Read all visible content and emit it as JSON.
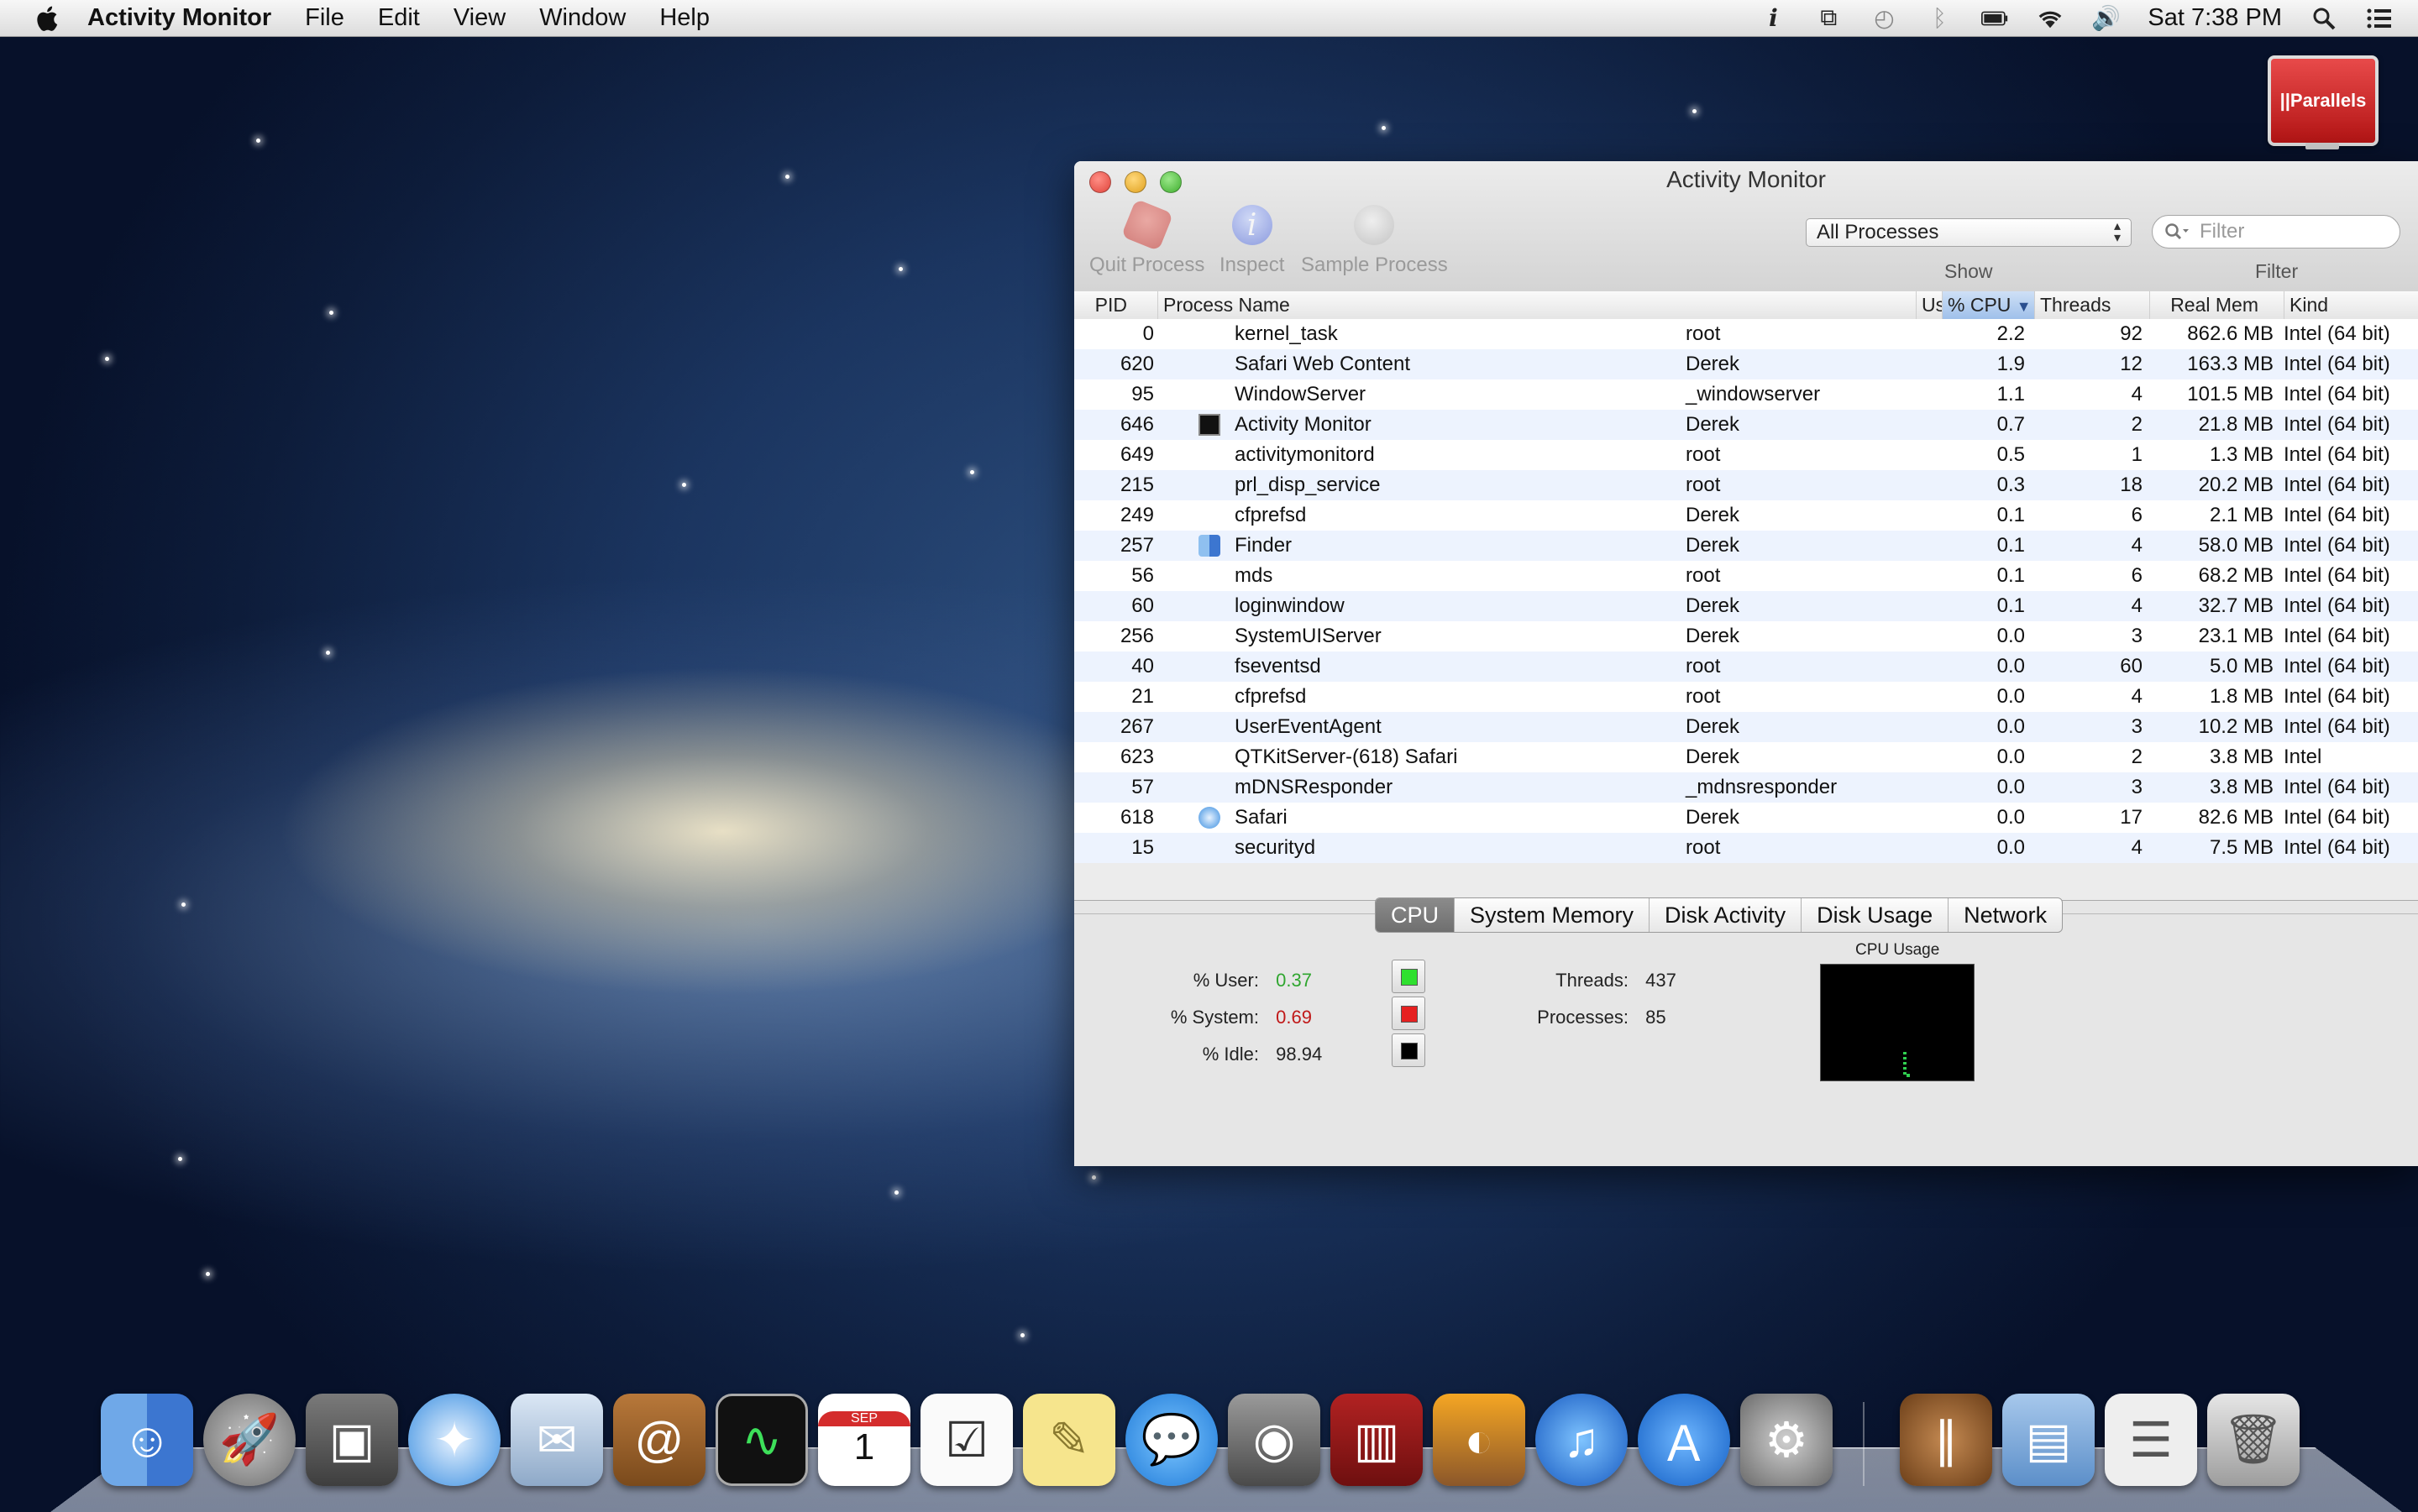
{
  "menubar": {
    "app_name": "Activity Monitor",
    "menus": [
      "File",
      "Edit",
      "View",
      "Window",
      "Help"
    ],
    "clock": "Sat 7:38 PM",
    "status_icons": [
      "info-icon",
      "mirror-icon",
      "time-machine-icon",
      "bluetooth-icon",
      "battery-icon",
      "wifi-icon",
      "volume-icon"
    ]
  },
  "parallels": {
    "label": "||Parallels"
  },
  "window": {
    "title": "Activity Monitor",
    "toolbar": {
      "quit": "Quit Process",
      "inspect": "Inspect",
      "sample": "Sample Process",
      "show_value": "All Processes",
      "show_label": "Show",
      "filter_placeholder": "Filter",
      "filter_label": "Filter"
    },
    "columns": {
      "pid": "PID",
      "name": "Process Name",
      "user": "User",
      "cpu": "% CPU",
      "threads": "Threads",
      "mem": "Real Mem",
      "kind": "Kind"
    },
    "rows": [
      {
        "pid": "0",
        "name": "kernel_task",
        "user": "root",
        "cpu": "2.2",
        "threads": "92",
        "mem": "862.6 MB",
        "kind": "Intel (64 bit)",
        "icon": ""
      },
      {
        "pid": "620",
        "name": "Safari Web Content",
        "user": "Derek",
        "cpu": "1.9",
        "threads": "12",
        "mem": "163.3 MB",
        "kind": "Intel (64 bit)",
        "icon": ""
      },
      {
        "pid": "95",
        "name": "WindowServer",
        "user": "_windowserver",
        "cpu": "1.1",
        "threads": "4",
        "mem": "101.5 MB",
        "kind": "Intel (64 bit)",
        "icon": ""
      },
      {
        "pid": "646",
        "name": "Activity Monitor",
        "user": "Derek",
        "cpu": "0.7",
        "threads": "2",
        "mem": "21.8 MB",
        "kind": "Intel (64 bit)",
        "icon": "activity-monitor-icon"
      },
      {
        "pid": "649",
        "name": "activitymonitord",
        "user": "root",
        "cpu": "0.5",
        "threads": "1",
        "mem": "1.3 MB",
        "kind": "Intel (64 bit)",
        "icon": ""
      },
      {
        "pid": "215",
        "name": "prl_disp_service",
        "user": "root",
        "cpu": "0.3",
        "threads": "18",
        "mem": "20.2 MB",
        "kind": "Intel (64 bit)",
        "icon": ""
      },
      {
        "pid": "249",
        "name": "cfprefsd",
        "user": "Derek",
        "cpu": "0.1",
        "threads": "6",
        "mem": "2.1 MB",
        "kind": "Intel (64 bit)",
        "icon": ""
      },
      {
        "pid": "257",
        "name": "Finder",
        "user": "Derek",
        "cpu": "0.1",
        "threads": "4",
        "mem": "58.0 MB",
        "kind": "Intel (64 bit)",
        "icon": "finder-icon"
      },
      {
        "pid": "56",
        "name": "mds",
        "user": "root",
        "cpu": "0.1",
        "threads": "6",
        "mem": "68.2 MB",
        "kind": "Intel (64 bit)",
        "icon": ""
      },
      {
        "pid": "60",
        "name": "loginwindow",
        "user": "Derek",
        "cpu": "0.1",
        "threads": "4",
        "mem": "32.7 MB",
        "kind": "Intel (64 bit)",
        "icon": ""
      },
      {
        "pid": "256",
        "name": "SystemUIServer",
        "user": "Derek",
        "cpu": "0.0",
        "threads": "3",
        "mem": "23.1 MB",
        "kind": "Intel (64 bit)",
        "icon": ""
      },
      {
        "pid": "40",
        "name": "fseventsd",
        "user": "root",
        "cpu": "0.0",
        "threads": "60",
        "mem": "5.0 MB",
        "kind": "Intel (64 bit)",
        "icon": ""
      },
      {
        "pid": "21",
        "name": "cfprefsd",
        "user": "root",
        "cpu": "0.0",
        "threads": "4",
        "mem": "1.8 MB",
        "kind": "Intel (64 bit)",
        "icon": ""
      },
      {
        "pid": "267",
        "name": "UserEventAgent",
        "user": "Derek",
        "cpu": "0.0",
        "threads": "3",
        "mem": "10.2 MB",
        "kind": "Intel (64 bit)",
        "icon": ""
      },
      {
        "pid": "623",
        "name": "QTKitServer-(618) Safari",
        "user": "Derek",
        "cpu": "0.0",
        "threads": "2",
        "mem": "3.8 MB",
        "kind": "Intel",
        "icon": ""
      },
      {
        "pid": "57",
        "name": "mDNSResponder",
        "user": "_mdnsresponder",
        "cpu": "0.0",
        "threads": "3",
        "mem": "3.8 MB",
        "kind": "Intel (64 bit)",
        "icon": ""
      },
      {
        "pid": "618",
        "name": "Safari",
        "user": "Derek",
        "cpu": "0.0",
        "threads": "17",
        "mem": "82.6 MB",
        "kind": "Intel (64 bit)",
        "icon": "safari-icon"
      },
      {
        "pid": "15",
        "name": "securityd",
        "user": "root",
        "cpu": "0.0",
        "threads": "4",
        "mem": "7.5 MB",
        "kind": "Intel (64 bit)",
        "icon": ""
      }
    ],
    "tabs": [
      "CPU",
      "System Memory",
      "Disk Activity",
      "Disk Usage",
      "Network"
    ],
    "active_tab": "CPU",
    "cpu_stats": {
      "user_label": "% User:",
      "user_value": "0.37",
      "user_color": "#2fa62f",
      "system_label": "% System:",
      "system_value": "0.69",
      "system_color": "#c01818",
      "idle_label": "% Idle:",
      "idle_value": "98.94",
      "threads_label": "Threads:",
      "threads_value": "437",
      "processes_label": "Processes:",
      "processes_value": "85",
      "graph_title": "CPU Usage"
    }
  },
  "dock": {
    "items": [
      "finder-icon",
      "launchpad-icon",
      "image-capture-icon",
      "safari-icon",
      "mail-icon",
      "contacts-icon",
      "activity-monitor-icon",
      "calendar-icon",
      "reminders-icon",
      "notes-icon",
      "messages-icon",
      "facetime-icon",
      "photo-booth-icon",
      "iphoto-icon",
      "itunes-icon",
      "app-store-icon",
      "system-preferences-icon",
      "parallels-icon",
      "applications-folder-icon",
      "documents-stack-icon",
      "trash-icon"
    ],
    "calendar_month": "SEP",
    "calendar_day": "1"
  }
}
